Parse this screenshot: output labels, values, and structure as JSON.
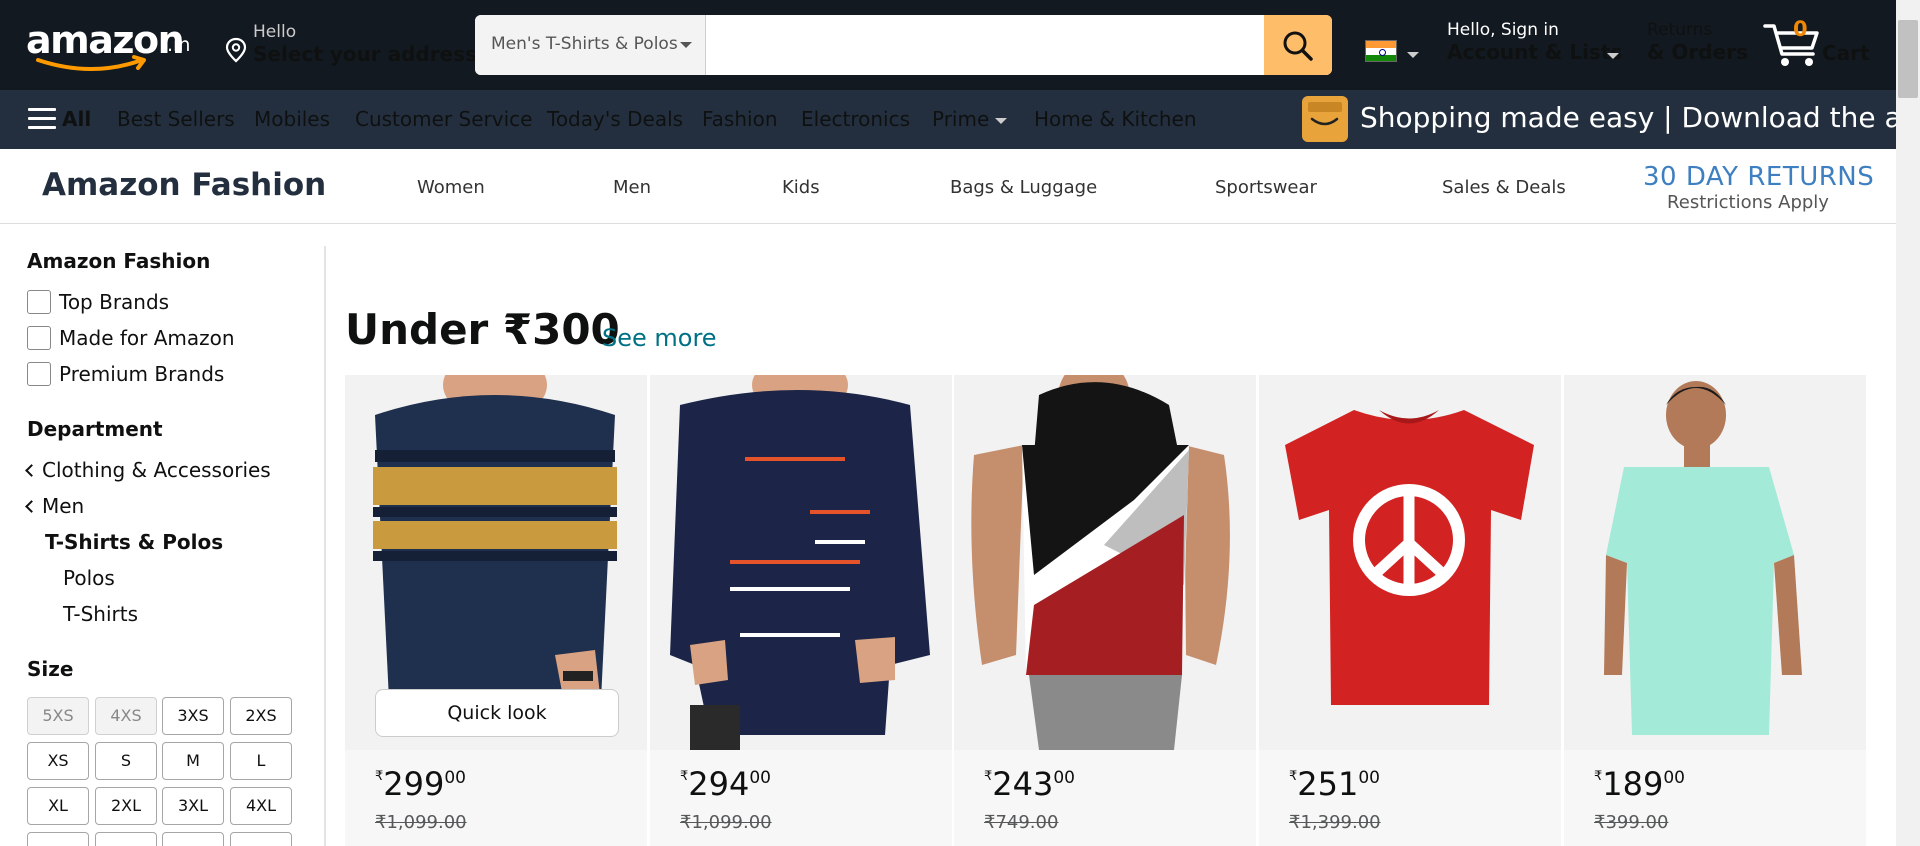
{
  "header": {
    "logo_word": "amazon",
    "logo_tld": ".in",
    "address_hello": "Hello",
    "address_line": "Select your address",
    "search_category": "Men's T-Shirts & Polos",
    "search_placeholder": "",
    "account_hello": "Hello, Sign in",
    "account_line": "Account & Lists",
    "returns_top": "Returns",
    "returns_bottom": "& Orders",
    "cart_count": "0",
    "cart_label": "Cart",
    "flag": "india-flag-icon"
  },
  "subnav": {
    "all": "All",
    "items": [
      "Best Sellers",
      "Mobiles",
      "Customer Service",
      "Today's Deals",
      "Fashion",
      "Electronics",
      "Prime",
      "Home & Kitchen"
    ],
    "promo": "Shopping made easy | Download the app"
  },
  "fashion_nav": {
    "title": "Amazon Fashion",
    "links": [
      "Women",
      "Men",
      "Kids",
      "Bags & Luggage",
      "Sportswear",
      "Sales & Deals"
    ],
    "returns_title": "30 DAY RETURNS",
    "returns_sub": "Restrictions Apply"
  },
  "sidebar": {
    "brand_heading": "Amazon Fashion",
    "brand_filters": [
      "Top Brands",
      "Made for Amazon",
      "Premium Brands"
    ],
    "department_heading": "Department",
    "back_links": [
      "Clothing & Accessories",
      "Men"
    ],
    "current": "T-Shirts & Polos",
    "sub_items": [
      "Polos",
      "T-Shirts"
    ],
    "size_heading": "Size",
    "sizes": [
      {
        "label": "5XS",
        "disabled": true
      },
      {
        "label": "4XS",
        "disabled": true
      },
      {
        "label": "3XS",
        "disabled": false
      },
      {
        "label": "2XS",
        "disabled": false
      },
      {
        "label": "XS",
        "disabled": false
      },
      {
        "label": "S",
        "disabled": false
      },
      {
        "label": "M",
        "disabled": false
      },
      {
        "label": "L",
        "disabled": false
      },
      {
        "label": "XL",
        "disabled": false
      },
      {
        "label": "2XL",
        "disabled": false
      },
      {
        "label": "3XL",
        "disabled": false
      },
      {
        "label": "4XL",
        "disabled": false
      }
    ]
  },
  "section": {
    "title": "Under ₹300",
    "see_more": "See more",
    "quick_look": "Quick look"
  },
  "products": [
    {
      "symbol": "₹",
      "whole": "299",
      "fraction": "00",
      "mrp": "₹1,099.00",
      "image": "navy-mustard-striped-sweatshirt"
    },
    {
      "symbol": "₹",
      "whole": "294",
      "fraction": "00",
      "mrp": "₹1,099.00",
      "image": "navy-long-sleeve-stripe-tshirt"
    },
    {
      "symbol": "₹",
      "whole": "243",
      "fraction": "00",
      "mrp": "₹749.00",
      "image": "colorblock-sleeveless-hoodie"
    },
    {
      "symbol": "₹",
      "whole": "251",
      "fraction": "00",
      "mrp": "₹1,399.00",
      "image": "red-peace-sign-tshirt"
    },
    {
      "symbol": "₹",
      "whole": "189",
      "fraction": "00",
      "mrp": "₹399.00",
      "image": "mint-plain-tshirt"
    }
  ],
  "colors": {
    "nav_dark": "#131921",
    "nav_secondary": "#232f3e",
    "search_button": "#febd69",
    "link": "#007185",
    "cart_count": "#f08804",
    "returns_blue": "#3d7fc1"
  }
}
